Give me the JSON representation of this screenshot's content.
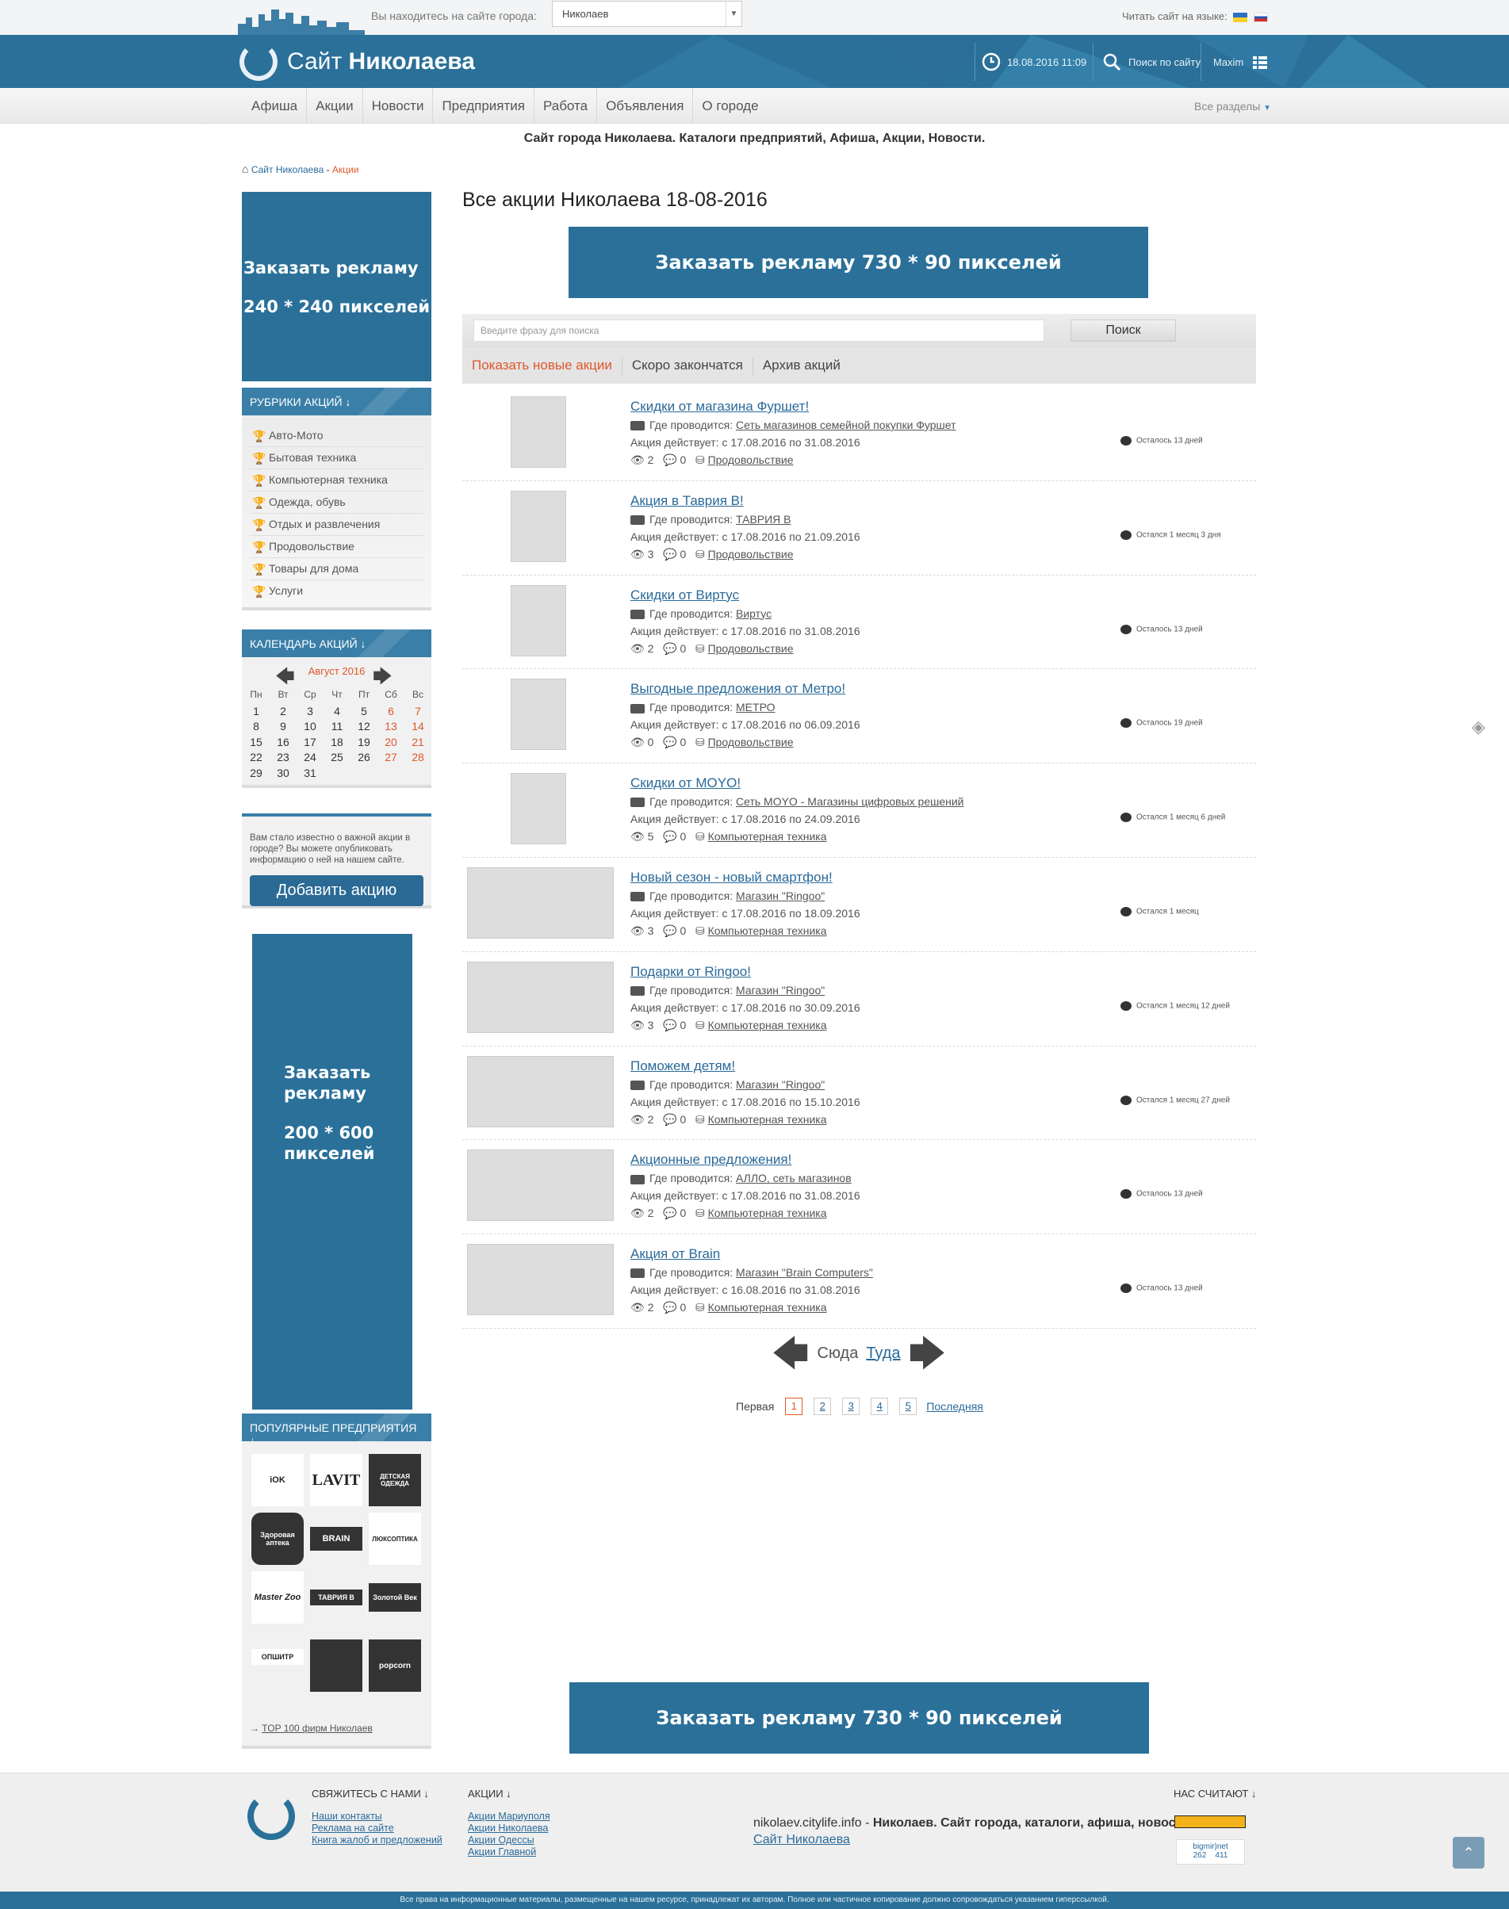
{
  "topbar": {
    "location_label": "Вы находитесь на сайте города:",
    "city_value": "Николаев",
    "lang_label": "Читать сайт на языке:"
  },
  "header": {
    "logo_light": "Сайт",
    "logo_bold": "Николаева",
    "datetime": "18.08.2016 11:09",
    "search_label": "Поиск по сайту",
    "user": "Maxim"
  },
  "nav": {
    "items": [
      "Афиша",
      "Акции",
      "Новости",
      "Предприятия",
      "Работа",
      "Объявления",
      "О городе"
    ],
    "all_sections": "Все разделы"
  },
  "tagline": "Сайт города Николаева. Каталоги предприятий, Афиша, Акции, Новости.",
  "breadcrumb": {
    "home": "Сайт Николаева",
    "sep": " - ",
    "current": "Акции"
  },
  "ads": {
    "left1_line1": "Заказать рекламу",
    "left1_line2": "240 * 240 пикселей",
    "top": "Заказать рекламу 730 * 90 пикселей",
    "left2_line1": "Заказать рекламу",
    "left2_line2": "200 * 600 пикселей",
    "bottom": "Заказать рекламу 730 * 90 пикселей"
  },
  "rubrics": {
    "title": "РУБРИКИ АКЦИЙ ↓",
    "items": [
      "Авто-Мото",
      "Бытовая техника",
      "Компьютерная техника",
      "Одежда, обувь",
      "Отдых и развлечения",
      "Продовольствие",
      "Товары для дома",
      "Услуги"
    ]
  },
  "calendar": {
    "title": "КАЛЕНДАРЬ АКЦИЙ ↓",
    "month": "Август 2016",
    "dow": [
      "Пн",
      "Вт",
      "Ср",
      "Чт",
      "Пт",
      "Сб",
      "Вс"
    ],
    "weeks": [
      [
        "1",
        "2",
        "3",
        "4",
        "5",
        "6",
        "7"
      ],
      [
        "8",
        "9",
        "10",
        "11",
        "12",
        "13",
        "14"
      ],
      [
        "15",
        "16",
        "17",
        "18",
        "19",
        "20",
        "21"
      ],
      [
        "22",
        "23",
        "24",
        "25",
        "26",
        "27",
        "28"
      ],
      [
        "29",
        "30",
        "31",
        "",
        "",
        "",
        ""
      ]
    ]
  },
  "addbox": {
    "text": "Вам стало известно о важной акции в городе? Вы можете опубликовать информацию о ней на нашем сайте.",
    "button": "Добавить акцию"
  },
  "popular": {
    "title": "ПОПУЛЯРНЫЕ ПРЕДПРИЯТИЯ ↓",
    "logos": [
      "iOK",
      "LAVIT",
      "ДЕТСКАЯ ОДЕЖДА",
      "Здоровая аптека",
      "BRAIN",
      "ЛЮКСОПТИКА",
      "Master Zoo",
      "ТАВРИЯ В",
      "Золотой Век",
      "ОПШИТР",
      "",
      "popcorn"
    ],
    "top100": "TOP 100 фирм Николаев"
  },
  "main": {
    "title": "Все акции Николаева 18-08-2016",
    "search_placeholder": "Введите фразу для поиска",
    "search_button": "Поиск",
    "filters": [
      "Показать новые акции",
      "Скоро закончатся",
      "Архив акций"
    ]
  },
  "promos": [
    {
      "title": "Скидки от магазина Фуршет!",
      "where": "Сеть магазинов семейной покупки Фуршет",
      "period": "с 17.08.2016 по 31.08.2016",
      "views": "2",
      "comments": "0",
      "category": "Продовольствие",
      "left": "Осталось 13 дней",
      "wide": false
    },
    {
      "title": "Акция в Таврия В!",
      "where": "ТАВРИЯ В",
      "period": "с 17.08.2016 по 21.09.2016",
      "views": "3",
      "comments": "0",
      "category": "Продовольствие",
      "left": "Остался 1 месяц 3 дня",
      "wide": false
    },
    {
      "title": "Скидки от Виртус",
      "where": "Виртус",
      "period": "с 17.08.2016 по 31.08.2016",
      "views": "2",
      "comments": "0",
      "category": "Продовольствие",
      "left": "Осталось 13 дней",
      "wide": false
    },
    {
      "title": "Выгодные предложения от Метро!",
      "where": "МЕТРО",
      "period": "с 17.08.2016 по 06.09.2016",
      "views": "0",
      "comments": "0",
      "category": "Продовольствие",
      "left": "Осталось 19 дней",
      "wide": false
    },
    {
      "title": "Скидки от MOYO!",
      "where": "Сеть MOYO - Магазины цифровых решений",
      "period": "с 17.08.2016 по 24.09.2016",
      "views": "5",
      "comments": "0",
      "category": "Компьютерная техника",
      "left": "Остался 1 месяц 6 дней",
      "wide": false
    },
    {
      "title": "Новый сезон - новый смартфон!",
      "where": "Магазин \"Ringoo\"",
      "period": "с 17.08.2016 по 18.09.2016",
      "views": "3",
      "comments": "0",
      "category": "Компьютерная техника",
      "left": "Остался 1 месяц",
      "wide": true
    },
    {
      "title": "Подарки от Ringoo!",
      "where": "Магазин \"Ringoo\"",
      "period": "с 17.08.2016 по 30.09.2016",
      "views": "3",
      "comments": "0",
      "category": "Компьютерная техника",
      "left": "Остался 1 месяц 12 дней",
      "wide": true
    },
    {
      "title": "Поможем детям!",
      "where": "Магазин \"Ringoo\"",
      "period": "с 17.08.2016 по 15.10.2016",
      "views": "2",
      "comments": "0",
      "category": "Компьютерная техника",
      "left": "Остался 1 месяц 27 дней",
      "wide": true
    },
    {
      "title": "Акционные предложения!",
      "where": "АЛЛО, сеть магазинов",
      "period": "с 17.08.2016 по 31.08.2016",
      "views": "2",
      "comments": "0",
      "category": "Компьютерная техника",
      "left": "Осталось 13 дней",
      "wide": true
    },
    {
      "title": "Акция от Brain",
      "where": "Магазин \"Brain Computers\"",
      "period": "с 16.08.2016 по 31.08.2016",
      "views": "2",
      "comments": "0",
      "category": "Компьютерная техника",
      "left": "Осталось 13 дней",
      "wide": true
    }
  ],
  "promo_labels": {
    "where": "Где проводится:",
    "period": "Акция действует:"
  },
  "pager": {
    "prev": "Сюда",
    "next": "Туда",
    "first": "Первая",
    "pages": [
      "1",
      "2",
      "3",
      "4",
      "5"
    ],
    "last": "Последняя"
  },
  "footer": {
    "contact_title": "СВЯЖИТЕСЬ С НАМИ ↓",
    "contact_links": [
      "Наши контакты",
      "Реклама на сайте",
      "Книга жалоб и предложений"
    ],
    "promo_title": "АКЦИИ ↓",
    "promo_links": [
      "Акции Мариуполя",
      "Акции Николаева",
      "Акции Одессы",
      "Акции Главной"
    ],
    "site_host": "nikolaev.citylife.info",
    "site_desc": "Николаев. Сайт города, каталоги, афиша, новости",
    "site_link": "Сайт Николаева",
    "counter_title": "НАС СЧИТАЮТ ↓",
    "counter_name": "bigmir)net",
    "counter_a": "262",
    "counter_b": "411",
    "copyright": "Все права на информационные материалы, размещенные на нашем ресурсе, принадлежат их авторам. Полное или частичное копирование должно сопровождаться указанием гиперссылкой."
  },
  "colors": {
    "brand": "#2a7099",
    "accent": "#e0572a",
    "link": "#2a6a9a"
  }
}
